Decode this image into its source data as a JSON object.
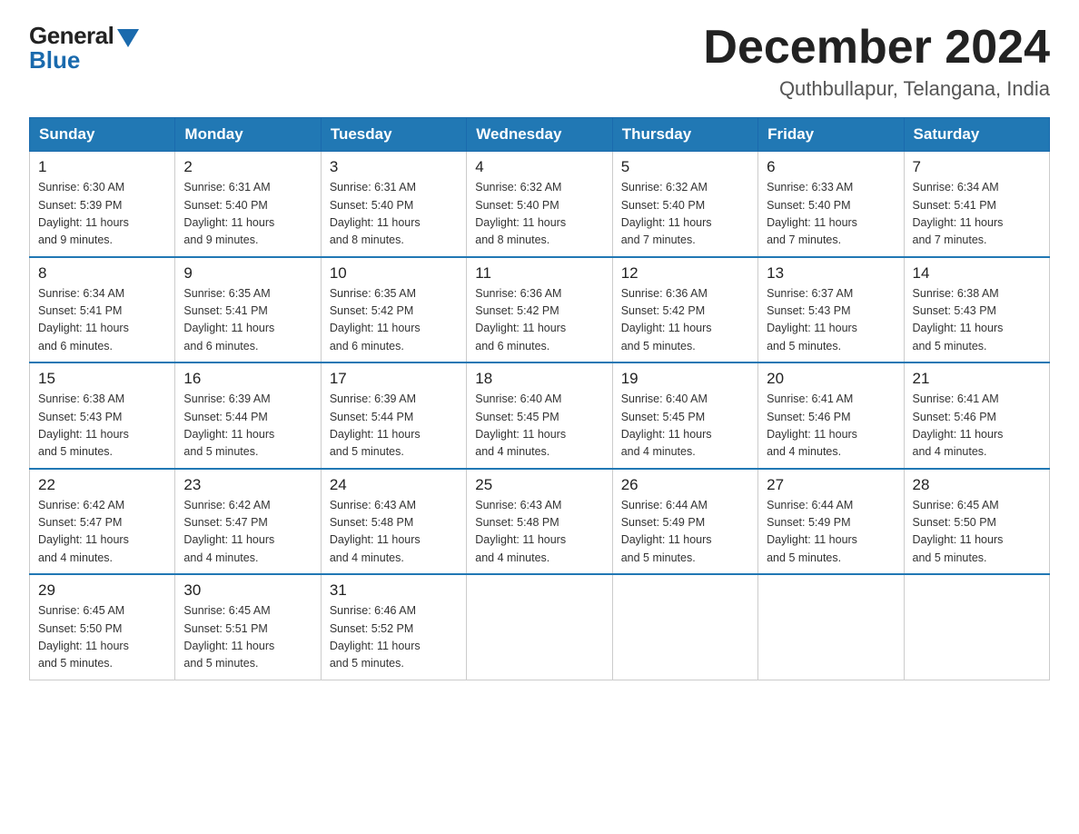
{
  "logo": {
    "general": "General",
    "blue": "Blue"
  },
  "title": "December 2024",
  "subtitle": "Quthbullapur, Telangana, India",
  "days_header": [
    "Sunday",
    "Monday",
    "Tuesday",
    "Wednesday",
    "Thursday",
    "Friday",
    "Saturday"
  ],
  "weeks": [
    [
      {
        "day": "1",
        "sunrise": "6:30 AM",
        "sunset": "5:39 PM",
        "daylight": "11 hours and 9 minutes."
      },
      {
        "day": "2",
        "sunrise": "6:31 AM",
        "sunset": "5:40 PM",
        "daylight": "11 hours and 9 minutes."
      },
      {
        "day": "3",
        "sunrise": "6:31 AM",
        "sunset": "5:40 PM",
        "daylight": "11 hours and 8 minutes."
      },
      {
        "day": "4",
        "sunrise": "6:32 AM",
        "sunset": "5:40 PM",
        "daylight": "11 hours and 8 minutes."
      },
      {
        "day": "5",
        "sunrise": "6:32 AM",
        "sunset": "5:40 PM",
        "daylight": "11 hours and 7 minutes."
      },
      {
        "day": "6",
        "sunrise": "6:33 AM",
        "sunset": "5:40 PM",
        "daylight": "11 hours and 7 minutes."
      },
      {
        "day": "7",
        "sunrise": "6:34 AM",
        "sunset": "5:41 PM",
        "daylight": "11 hours and 7 minutes."
      }
    ],
    [
      {
        "day": "8",
        "sunrise": "6:34 AM",
        "sunset": "5:41 PM",
        "daylight": "11 hours and 6 minutes."
      },
      {
        "day": "9",
        "sunrise": "6:35 AM",
        "sunset": "5:41 PM",
        "daylight": "11 hours and 6 minutes."
      },
      {
        "day": "10",
        "sunrise": "6:35 AM",
        "sunset": "5:42 PM",
        "daylight": "11 hours and 6 minutes."
      },
      {
        "day": "11",
        "sunrise": "6:36 AM",
        "sunset": "5:42 PM",
        "daylight": "11 hours and 6 minutes."
      },
      {
        "day": "12",
        "sunrise": "6:36 AM",
        "sunset": "5:42 PM",
        "daylight": "11 hours and 5 minutes."
      },
      {
        "day": "13",
        "sunrise": "6:37 AM",
        "sunset": "5:43 PM",
        "daylight": "11 hours and 5 minutes."
      },
      {
        "day": "14",
        "sunrise": "6:38 AM",
        "sunset": "5:43 PM",
        "daylight": "11 hours and 5 minutes."
      }
    ],
    [
      {
        "day": "15",
        "sunrise": "6:38 AM",
        "sunset": "5:43 PM",
        "daylight": "11 hours and 5 minutes."
      },
      {
        "day": "16",
        "sunrise": "6:39 AM",
        "sunset": "5:44 PM",
        "daylight": "11 hours and 5 minutes."
      },
      {
        "day": "17",
        "sunrise": "6:39 AM",
        "sunset": "5:44 PM",
        "daylight": "11 hours and 5 minutes."
      },
      {
        "day": "18",
        "sunrise": "6:40 AM",
        "sunset": "5:45 PM",
        "daylight": "11 hours and 4 minutes."
      },
      {
        "day": "19",
        "sunrise": "6:40 AM",
        "sunset": "5:45 PM",
        "daylight": "11 hours and 4 minutes."
      },
      {
        "day": "20",
        "sunrise": "6:41 AM",
        "sunset": "5:46 PM",
        "daylight": "11 hours and 4 minutes."
      },
      {
        "day": "21",
        "sunrise": "6:41 AM",
        "sunset": "5:46 PM",
        "daylight": "11 hours and 4 minutes."
      }
    ],
    [
      {
        "day": "22",
        "sunrise": "6:42 AM",
        "sunset": "5:47 PM",
        "daylight": "11 hours and 4 minutes."
      },
      {
        "day": "23",
        "sunrise": "6:42 AM",
        "sunset": "5:47 PM",
        "daylight": "11 hours and 4 minutes."
      },
      {
        "day": "24",
        "sunrise": "6:43 AM",
        "sunset": "5:48 PM",
        "daylight": "11 hours and 4 minutes."
      },
      {
        "day": "25",
        "sunrise": "6:43 AM",
        "sunset": "5:48 PM",
        "daylight": "11 hours and 4 minutes."
      },
      {
        "day": "26",
        "sunrise": "6:44 AM",
        "sunset": "5:49 PM",
        "daylight": "11 hours and 5 minutes."
      },
      {
        "day": "27",
        "sunrise": "6:44 AM",
        "sunset": "5:49 PM",
        "daylight": "11 hours and 5 minutes."
      },
      {
        "day": "28",
        "sunrise": "6:45 AM",
        "sunset": "5:50 PM",
        "daylight": "11 hours and 5 minutes."
      }
    ],
    [
      {
        "day": "29",
        "sunrise": "6:45 AM",
        "sunset": "5:50 PM",
        "daylight": "11 hours and 5 minutes."
      },
      {
        "day": "30",
        "sunrise": "6:45 AM",
        "sunset": "5:51 PM",
        "daylight": "11 hours and 5 minutes."
      },
      {
        "day": "31",
        "sunrise": "6:46 AM",
        "sunset": "5:52 PM",
        "daylight": "11 hours and 5 minutes."
      },
      null,
      null,
      null,
      null
    ]
  ],
  "labels": {
    "sunrise": "Sunrise:",
    "sunset": "Sunset:",
    "daylight": "Daylight:"
  },
  "colors": {
    "header_bg": "#2178b4",
    "header_text": "#ffffff",
    "border": "#2178b4"
  }
}
